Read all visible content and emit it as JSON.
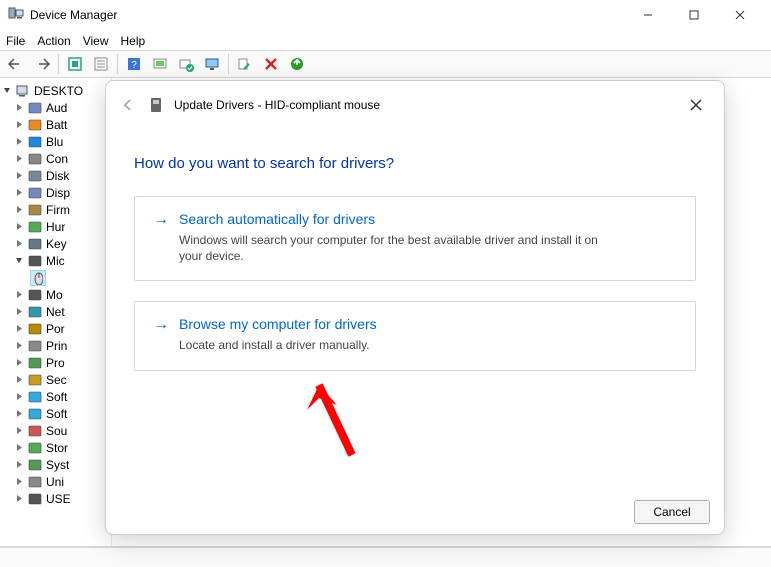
{
  "window": {
    "title": "Device Manager"
  },
  "menu": {
    "file": "File",
    "action": "Action",
    "view": "View",
    "help": "Help"
  },
  "tree": {
    "root": "DESKTO",
    "items": [
      {
        "label": "Aud"
      },
      {
        "label": "Batt"
      },
      {
        "label": "Blu"
      },
      {
        "label": "Con"
      },
      {
        "label": "Disk"
      },
      {
        "label": "Disp"
      },
      {
        "label": "Firm"
      },
      {
        "label": "Hur"
      },
      {
        "label": "Key"
      },
      {
        "label": "Mic",
        "expanded": true,
        "children": [
          {
            "label": ""
          }
        ]
      },
      {
        "label": "Mo"
      },
      {
        "label": "Net"
      },
      {
        "label": "Por"
      },
      {
        "label": "Prin"
      },
      {
        "label": "Pro"
      },
      {
        "label": "Sec"
      },
      {
        "label": "Soft"
      },
      {
        "label": "Soft"
      },
      {
        "label": "Sou"
      },
      {
        "label": "Stor"
      },
      {
        "label": "Syst"
      },
      {
        "label": "Uni"
      },
      {
        "label": "USE"
      }
    ]
  },
  "dialog": {
    "title": "Update Drivers - HID-compliant mouse",
    "heading": "How do you want to search for drivers?",
    "option1_title": "Search automatically for drivers",
    "option1_desc": "Windows will search your computer for the best available driver and install it on your device.",
    "option2_title": "Browse my computer for drivers",
    "option2_desc": "Locate and install a driver manually.",
    "cancel": "Cancel"
  }
}
